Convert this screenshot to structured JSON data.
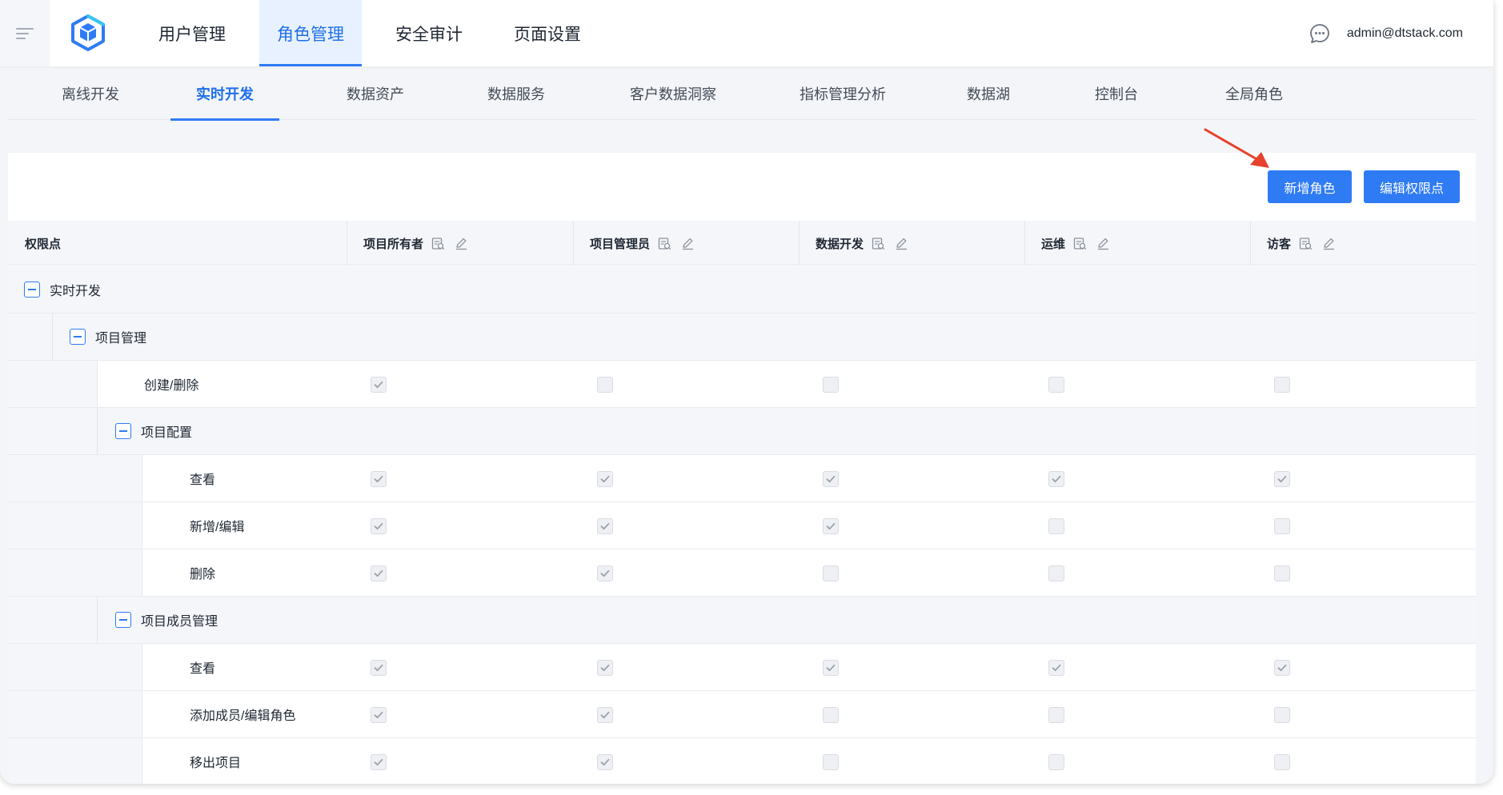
{
  "app": {
    "main_tabs": [
      {
        "label": "用户管理",
        "active": false
      },
      {
        "label": "角色管理",
        "active": true
      },
      {
        "label": "安全审计",
        "active": false
      },
      {
        "label": "页面设置",
        "active": false
      }
    ],
    "user_email": "admin@dtstack.com"
  },
  "subtabs": [
    {
      "label": "离线开发",
      "active": false
    },
    {
      "label": "实时开发",
      "active": true
    },
    {
      "label": "数据资产",
      "active": false
    },
    {
      "label": "数据服务",
      "active": false
    },
    {
      "label": "客户数据洞察",
      "active": false
    },
    {
      "label": "指标管理分析",
      "active": false
    },
    {
      "label": "数据湖",
      "active": false
    },
    {
      "label": "控制台",
      "active": false
    },
    {
      "label": "全局角色",
      "active": false
    }
  ],
  "actions": {
    "add_role": "新增角色",
    "edit_permissions": "编辑权限点"
  },
  "table": {
    "permission_header": "权限点",
    "roles": [
      "项目所有者",
      "项目管理员",
      "数据开发",
      "运维",
      "访客"
    ],
    "rows": [
      {
        "label": "实时开发",
        "level": 0,
        "type": "group",
        "checks": []
      },
      {
        "label": "项目管理",
        "level": 1,
        "type": "group",
        "checks": []
      },
      {
        "label": "创建/删除",
        "level": 2,
        "type": "leaf",
        "checks": [
          true,
          false,
          false,
          false,
          false
        ]
      },
      {
        "label": "项目配置",
        "level": 2,
        "type": "group",
        "checks": []
      },
      {
        "label": "查看",
        "level": 3,
        "type": "leaf",
        "checks": [
          true,
          true,
          true,
          true,
          true
        ]
      },
      {
        "label": "新增/编辑",
        "level": 3,
        "type": "leaf",
        "checks": [
          true,
          true,
          true,
          false,
          false
        ]
      },
      {
        "label": "删除",
        "level": 3,
        "type": "leaf",
        "checks": [
          true,
          true,
          false,
          false,
          false
        ]
      },
      {
        "label": "项目成员管理",
        "level": 2,
        "type": "group",
        "checks": []
      },
      {
        "label": "查看",
        "level": 3,
        "type": "leaf",
        "checks": [
          true,
          true,
          true,
          true,
          true
        ]
      },
      {
        "label": "添加成员/编辑角色",
        "level": 3,
        "type": "leaf",
        "checks": [
          true,
          true,
          false,
          false,
          false
        ]
      },
      {
        "label": "移出项目",
        "level": 3,
        "type": "leaf",
        "checks": [
          true,
          true,
          false,
          false,
          false
        ]
      }
    ]
  },
  "colors": {
    "accent": "#2f7bf3",
    "annotation_arrow": "#e8412c"
  },
  "icons": [
    "menu-icon",
    "app-logo-icon",
    "chat-icon",
    "view-icon",
    "edit-icon",
    "collapse-icon",
    "checkbox-check-icon",
    "annotation-arrow-icon"
  ]
}
